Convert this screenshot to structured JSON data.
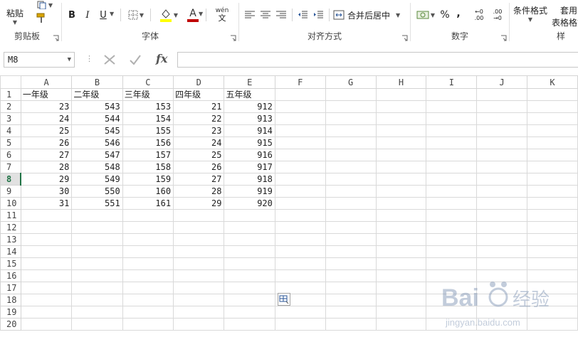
{
  "ribbon": {
    "clipboard": {
      "paste_label": "粘贴",
      "group_label": "剪贴板"
    },
    "font": {
      "group_label": "字体",
      "bold": "B",
      "italic": "I",
      "underline": "U",
      "font_color_label": "A",
      "phonetic_label": "wén",
      "phonetic_sub": "文"
    },
    "alignment": {
      "group_label": "对齐方式",
      "merge_label": "合并后居中"
    },
    "number": {
      "group_label": "数字",
      "percent": "%",
      "comma": ",",
      "inc_decimal": ".00",
      "dec_decimal": ".00"
    },
    "styles": {
      "conditional_label": "条件格式",
      "table_label_1": "套用",
      "table_label_2": "表格格式",
      "group_label": "样"
    }
  },
  "formula_bar": {
    "name_box": "M8",
    "fx": "fx",
    "formula": ""
  },
  "columns": [
    "A",
    "B",
    "C",
    "D",
    "E",
    "F",
    "G",
    "H",
    "I",
    "J",
    "K"
  ],
  "active_row": 8,
  "rows": [
    [
      "一年级",
      "二年级",
      "三年级",
      "四年级",
      "五年级"
    ],
    [
      "23",
      "543",
      "153",
      "21",
      "912"
    ],
    [
      "24",
      "544",
      "154",
      "22",
      "913"
    ],
    [
      "25",
      "545",
      "155",
      "23",
      "914"
    ],
    [
      "26",
      "546",
      "156",
      "24",
      "915"
    ],
    [
      "27",
      "547",
      "157",
      "25",
      "916"
    ],
    [
      "28",
      "548",
      "158",
      "26",
      "917"
    ],
    [
      "29",
      "549",
      "159",
      "27",
      "918"
    ],
    [
      "30",
      "550",
      "160",
      "28",
      "919"
    ],
    [
      "31",
      "551",
      "161",
      "29",
      "920"
    ],
    [],
    [],
    [],
    [],
    [],
    [],
    [],
    [],
    [],
    []
  ],
  "watermark": {
    "brand": "Bai",
    "brand2": "经验",
    "url": "jingyan.baidu.com"
  },
  "colors": {
    "excel_green": "#217346",
    "font_color_bar": "#c00000",
    "fill_color_bar": "#ffff00"
  }
}
